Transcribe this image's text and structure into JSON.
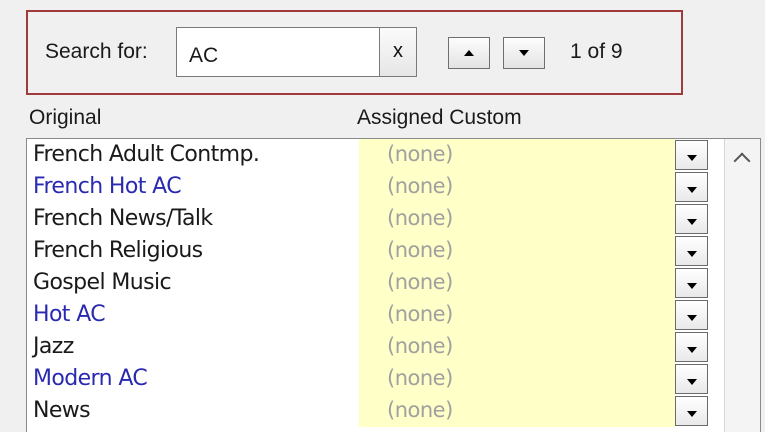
{
  "search": {
    "label": "Search for:",
    "value": "AC",
    "clear_label": "x",
    "result_count": "1 of 9"
  },
  "columns": {
    "original": "Original",
    "assigned": "Assigned Custom"
  },
  "colors": {
    "match_text": "#2a2ab0",
    "normal_text": "#1a1a1a",
    "assigned_bg": "#ffffc8",
    "search_frame_border": "#a03b3b"
  },
  "rows": [
    {
      "name": "French Adult Contmp.",
      "assigned": "(none)",
      "match": false
    },
    {
      "name": "French Hot AC",
      "assigned": "(none)",
      "match": true
    },
    {
      "name": "French News/Talk",
      "assigned": "(none)",
      "match": false
    },
    {
      "name": "French Religious",
      "assigned": "(none)",
      "match": false
    },
    {
      "name": "Gospel Music",
      "assigned": "(none)",
      "match": false
    },
    {
      "name": "Hot AC",
      "assigned": "(none)",
      "match": true
    },
    {
      "name": "Jazz",
      "assigned": "(none)",
      "match": false
    },
    {
      "name": "Modern AC",
      "assigned": "(none)",
      "match": true
    },
    {
      "name": "News",
      "assigned": "(none)",
      "match": false
    }
  ]
}
